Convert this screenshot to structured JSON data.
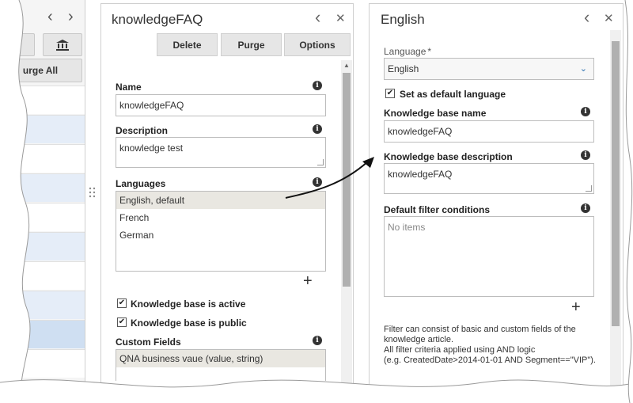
{
  "left_panel": {
    "purge_all_label": "urge All",
    "prev_icon": "chevron-left-icon",
    "next_icon": "chevron-right-icon",
    "bank_icon": "bank-icon"
  },
  "kb_panel": {
    "title": "knowledgeFAQ",
    "toolbar": {
      "delete": "Delete",
      "purge": "Purge",
      "options": "Options"
    },
    "name_label": "Name",
    "name_value": "knowledgeFAQ",
    "description_label": "Description",
    "description_value": "knowledge test",
    "languages_label": "Languages",
    "languages": [
      "English, default",
      "French",
      "German"
    ],
    "active_label": "Knowledge base is active",
    "public_label": "Knowledge base is public",
    "custom_fields_label": "Custom Fields",
    "custom_fields": [
      "QNA business vaue (value, string)"
    ],
    "add_symbol": "+"
  },
  "lang_panel": {
    "title": "English",
    "language_label": "Language",
    "required_mark": "*",
    "language_value": "English",
    "default_label": "Set as default language",
    "kb_name_label": "Knowledge base name",
    "kb_name_value": "knowledgeFAQ",
    "kb_desc_label": "Knowledge base description",
    "kb_desc_value": "knowledgeFAQ",
    "filter_label": "Default filter conditions",
    "filter_empty": "No items",
    "add_symbol": "+",
    "note_1": "Filter can consist of basic and custom fields of the knowledge article.",
    "note_2": "All filter criteria applied using AND logic",
    "note_3": "(e.g. CreatedDate>2014-01-01 AND Segment==\"VIP\")."
  },
  "icons": {
    "back": "chevron-left-icon",
    "close": "close-icon",
    "info": "info-icon",
    "dropdown": "chevron-down-icon",
    "check": "check-icon",
    "drag": "drag-handle-icon"
  },
  "colors": {
    "selected_row": "#e9e7e1",
    "button": "#e6e6e6",
    "highlight_row": "#e5edf8",
    "dropdown_arrow": "#2a6fb0"
  }
}
